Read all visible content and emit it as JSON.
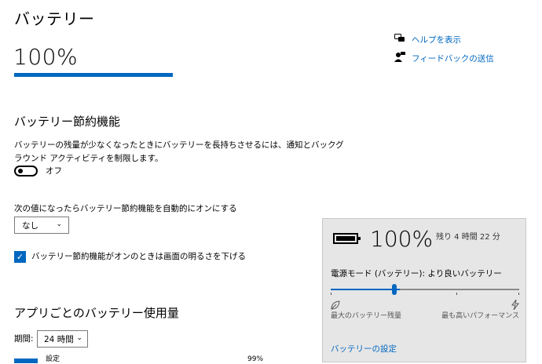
{
  "page": {
    "title": "バッテリー",
    "battery_percent_label": "100%",
    "battery_level": 1.0
  },
  "help": {
    "show_help": "ヘルプを表示",
    "send_feedback": "フィードバックの送信"
  },
  "saver": {
    "title": "バッテリー節約機能",
    "description_line1": "バッテリーの残量が少なくなったときにバッテリーを長持ちさせるには、通知とバックグ",
    "description_line2": "ラウンド アクティビティを制限します。",
    "toggle_state": "オフ",
    "auto_label": "次の値になったらバッテリー節約機能を自動的にオンにする",
    "auto_value": "なし",
    "brightness_label": "バッテリー節約機能がオンのときは画面の明るさを下げる",
    "brightness_checked": true
  },
  "usage": {
    "title": "アプリごとのバッテリー使用量",
    "period_label": "期間:",
    "period_value": "24 時間",
    "row_name": "設定",
    "row_percent": "99%"
  },
  "flyout": {
    "percent": "100%",
    "remaining": "残り 4 時間 22 分",
    "power_mode": "電源モード (バッテリー): より良いバッテリー",
    "left_label": "最大のバッテリー残量",
    "right_label": "最も高いパフォーマンス",
    "settings_link": "バッテリーの設定",
    "slider_level": 0.33
  },
  "colors": {
    "accent": "#0067c0",
    "flyout_bg": "#e6e6e6"
  }
}
